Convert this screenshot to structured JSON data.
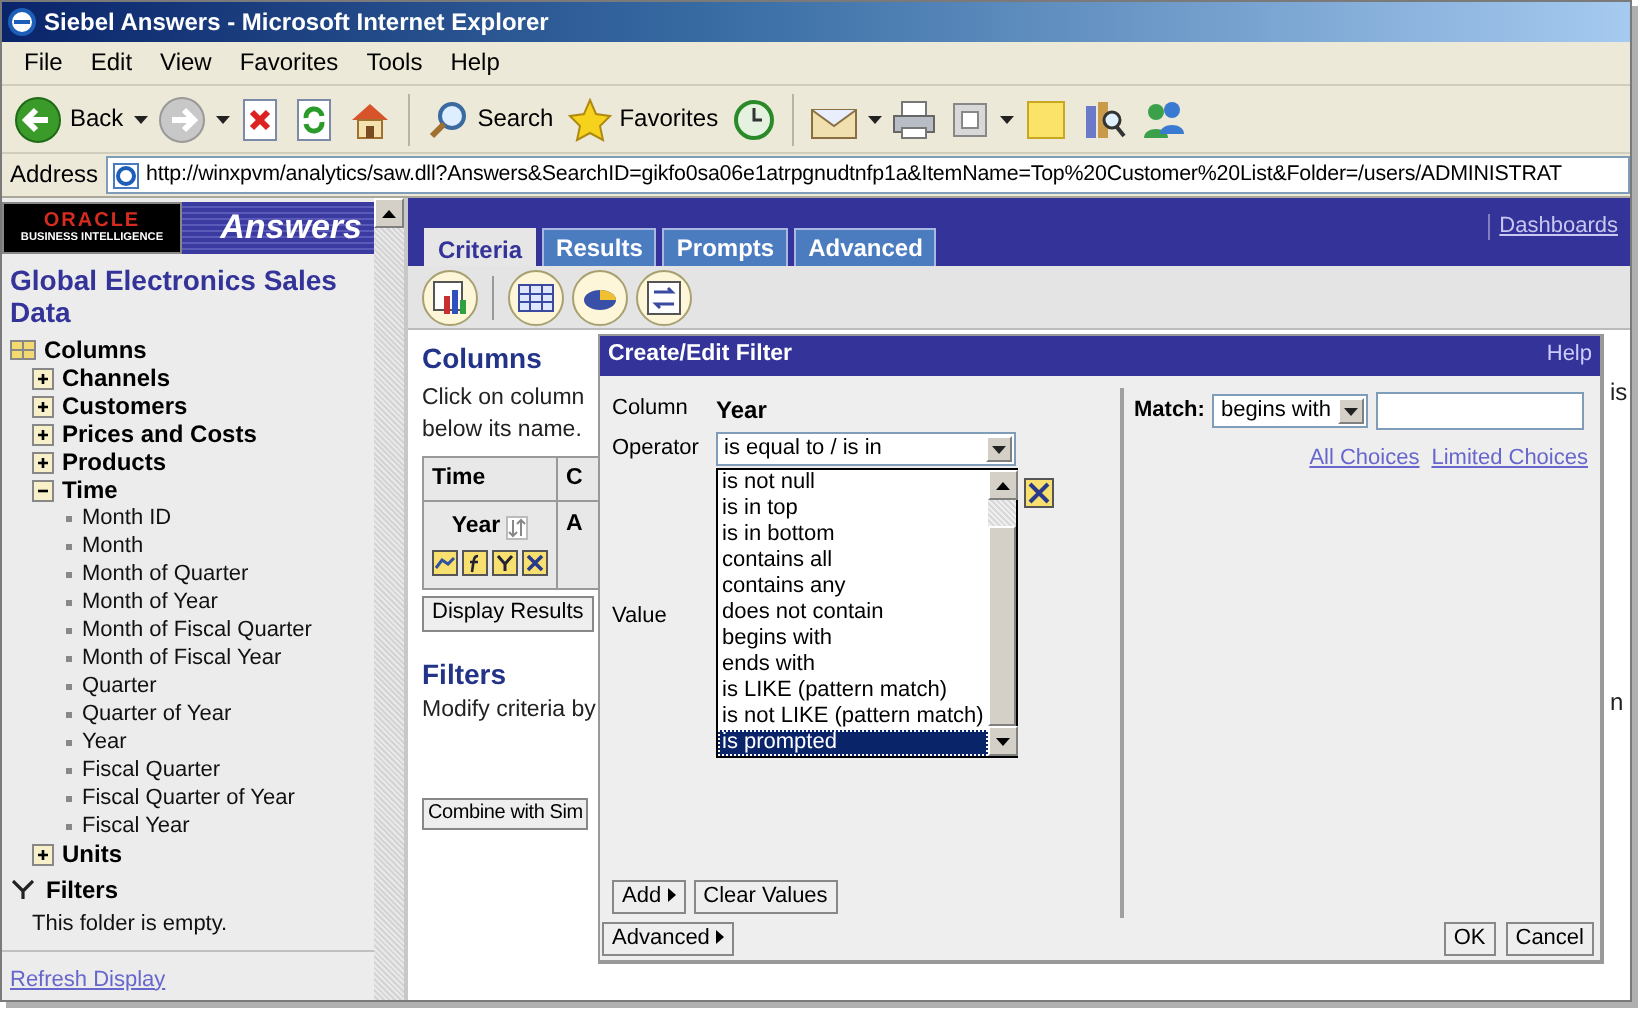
{
  "window": {
    "title": "Siebel Answers - Microsoft Internet Explorer"
  },
  "menu": [
    "File",
    "Edit",
    "View",
    "Favorites",
    "Tools",
    "Help"
  ],
  "toolbar": {
    "back": "Back",
    "search": "Search",
    "favorites": "Favorites"
  },
  "address": {
    "label": "Address",
    "url": "http://winxpvm/analytics/saw.dll?Answers&SearchID=gikfo0sa06e1atrpgnudtnfp1a&ItemName=Top%20Customer%20List&Folder=/users/ADMINISTRAT"
  },
  "logo": {
    "brand": "ORACLE",
    "tagline": "BUSINESS INTELLIGENCE",
    "product": "Answers"
  },
  "subject_area": "Global Electronics Sales Data",
  "tree": {
    "label": "Columns",
    "children": [
      {
        "label": "Channels",
        "expanded": false
      },
      {
        "label": "Customers",
        "expanded": false
      },
      {
        "label": "Prices and Costs",
        "expanded": false
      },
      {
        "label": "Products",
        "expanded": false
      },
      {
        "label": "Time",
        "expanded": true,
        "children": [
          {
            "label": "Month ID"
          },
          {
            "label": "Month"
          },
          {
            "label": "Month of Quarter"
          },
          {
            "label": "Month of Year"
          },
          {
            "label": "Month of Fiscal Quarter"
          },
          {
            "label": "Month of Fiscal Year"
          },
          {
            "label": "Quarter"
          },
          {
            "label": "Quarter of Year"
          },
          {
            "label": "Year"
          },
          {
            "label": "Fiscal Quarter"
          },
          {
            "label": "Fiscal Quarter of Year"
          },
          {
            "label": "Fiscal Year"
          }
        ]
      },
      {
        "label": "Units",
        "expanded": false
      }
    ]
  },
  "filters_pane": {
    "label": "Filters",
    "empty_text": "This folder is empty."
  },
  "refresh_link": "Refresh Display",
  "tabs": [
    {
      "label": "Criteria",
      "selected": true
    },
    {
      "label": "Results",
      "selected": false
    },
    {
      "label": "Prompts",
      "selected": false
    },
    {
      "label": "Advanced",
      "selected": false
    }
  ],
  "dashboards_link": "Dashboards",
  "criteria": {
    "columns_heading": "Columns",
    "columns_text": [
      "Click on column",
      "below its name."
    ],
    "table": {
      "header": [
        "Time",
        "C"
      ],
      "row": [
        "Year",
        "A"
      ]
    },
    "display_results_button": "Display Results",
    "filters_heading": "Filters",
    "filters_text": "Modify criteria by",
    "combine_button": "Combine with Sim",
    "right_fragments": [
      "is",
      "n"
    ]
  },
  "dialog": {
    "title": "Create/Edit Filter",
    "help": "Help",
    "column_label": "Column",
    "column_value": "Year",
    "operator_label": "Operator",
    "operator_value": "is equal to / is in",
    "operator_options": [
      {
        "label": "is not null",
        "selected": false
      },
      {
        "label": "is in top",
        "selected": false
      },
      {
        "label": "is in bottom",
        "selected": false
      },
      {
        "label": "contains all",
        "selected": false
      },
      {
        "label": "contains any",
        "selected": false
      },
      {
        "label": "does not contain",
        "selected": false
      },
      {
        "label": "begins with",
        "selected": false
      },
      {
        "label": "ends with",
        "selected": false
      },
      {
        "label": "is LIKE (pattern match)",
        "selected": false
      },
      {
        "label": "is not LIKE (pattern match)",
        "selected": false
      },
      {
        "label": "is prompted",
        "selected": true
      }
    ],
    "value_label": "Value",
    "add_button": "Add",
    "clear_button": "Clear Values",
    "match_label": "Match:",
    "match_value": "begins with",
    "links": [
      "All Choices",
      "Limited Choices"
    ],
    "advanced_button": "Advanced",
    "ok_button": "OK",
    "cancel_button": "Cancel"
  }
}
